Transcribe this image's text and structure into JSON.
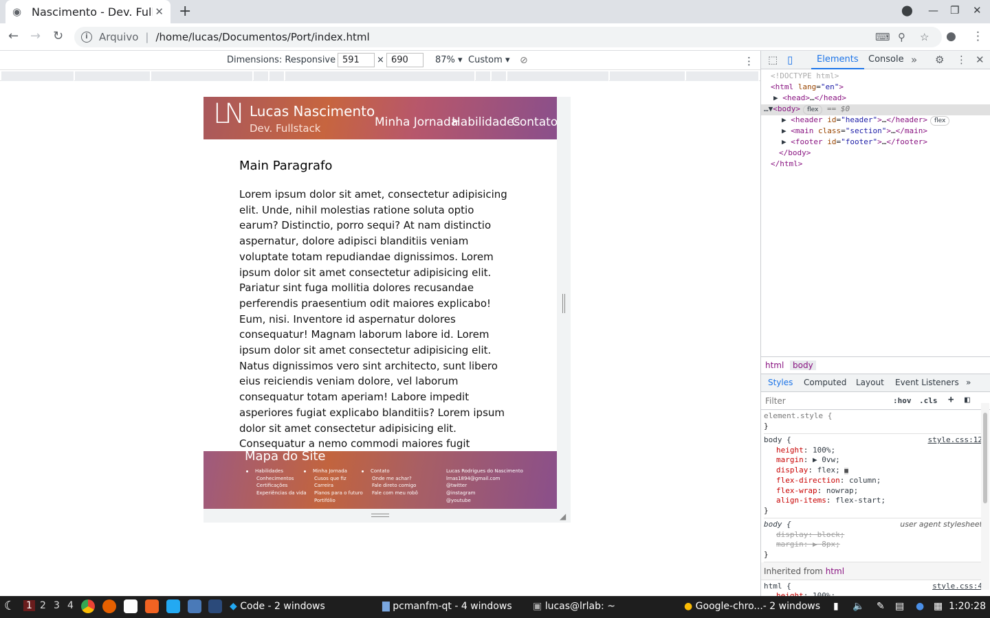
{
  "browser": {
    "tab_title": "Nascimento - Dev. Fullstack",
    "new_tab": "+",
    "address_scheme": "Arquivo",
    "address_path": "/home/lucas/Documentos/Port/index.html"
  },
  "device_toolbar": {
    "dimensions_label": "Dimensions: Responsive",
    "width": "591",
    "height": "690",
    "times": "×",
    "zoom": "87%",
    "throttle": "Custom"
  },
  "site": {
    "logo": "LN",
    "name": "Lucas Nascimento",
    "role": "Dev. Fullstack",
    "menu": [
      "Minha Jornada",
      "Habilidades",
      "Contato"
    ],
    "main_title": "Main Paragrafo",
    "main_text": "Lorem ipsum dolor sit amet, consectetur adipisicing elit. Unde, nihil molestias ratione soluta optio earum? Distinctio, porro sequi? At nam distinctio aspernatur, dolore adipisci blanditiis veniam voluptate totam repudiandae dignissimos. Lorem ipsum dolor sit amet consectetur adipisicing elit. Pariatur sint fuga mollitia dolores recusandae perferendis praesentium odit maiores explicabo! Eum, nisi. Inventore id aspernatur dolores consequatur! Magnam laborum labore id. Lorem ipsum dolor sit amet consectetur adipisicing elit. Natus dignissimos vero sint architecto, sunt libero eius reiciendis veniam dolore, vel laborum consequatur totam aperiam! Labore impedit asperiores fugiat explicabo blanditiis? Lorem ipsum dolor sit amet consectetur adipisicing elit. Consequatur a nemo commodi maiores fugit quisquam labore dolor deleniti, porro dicta tempora? Quod excepturi nemo voluptate! Explicabo",
    "footer": {
      "title": "Mapa do Site",
      "col1": {
        "head": "Habilidades",
        "items": [
          "Conhecimentos",
          "Certificações",
          "Experiências da vida"
        ]
      },
      "col2": {
        "head": "Minha Jornada",
        "items": [
          "Cusos que fiz",
          "Carreira",
          "Planos para o futuro",
          "Portifólio"
        ]
      },
      "col3": {
        "head": "Contato",
        "items": [
          "Onde me achar?",
          "Fale direto comigo",
          "Fale com meu robô"
        ]
      },
      "col4": {
        "items": [
          "Lucas Rodrigues do Nascimento",
          "lrnas1894@gmail.com",
          "@twitter",
          "@instagram",
          "@youtube"
        ]
      }
    }
  },
  "devtools": {
    "tabs": [
      "Elements",
      "Console"
    ],
    "dom": {
      "doctype": "<!DOCTYPE html>",
      "html_open": "html",
      "lang_attr": "lang",
      "lang_val": "en",
      "head": "head",
      "body": "body",
      "body_badge": "flex",
      "eq": "== $0",
      "header_id": "header",
      "header_badge": "flex",
      "main_class": "section",
      "footer_id": "footer",
      "ellipsis": "…"
    },
    "breadcrumbs": [
      "html",
      "body"
    ],
    "style_tabs": [
      "Styles",
      "Computed",
      "Layout",
      "Event Listeners"
    ],
    "filter_placeholder": "Filter",
    "hov": ":hov",
    "cls": ".cls",
    "element_style": "element.style {",
    "rule1": {
      "selector": "body {",
      "source": "style.css:12",
      "props": [
        {
          "n": "height",
          "v": "100%;"
        },
        {
          "n": "margin",
          "v": "▶ 0vw;"
        },
        {
          "n": "display",
          "v": "flex;"
        },
        {
          "n": "flex-direction",
          "v": "column;"
        },
        {
          "n": "flex-wrap",
          "v": "nowrap;"
        },
        {
          "n": "align-items",
          "v": "flex-start;"
        }
      ]
    },
    "rule2": {
      "selector": "body {",
      "source": "user agent stylesheet",
      "props": [
        {
          "n": "display",
          "v": "block;"
        },
        {
          "n": "margin",
          "v": "▶ 8px;"
        }
      ]
    },
    "inherited_label": "Inherited from",
    "inherited_tag": "html",
    "rule3": {
      "selector": "html {",
      "source": "style.css:4",
      "props": [
        {
          "n": "height",
          "v": "100%;"
        }
      ]
    },
    "close_brace": "}"
  },
  "taskbar": {
    "workspaces": [
      "1",
      "2",
      "3",
      "4"
    ],
    "active_workspace": "1",
    "windows": [
      "Code - 2 windows",
      "pcmanfm-qt - 4 windows",
      "lucas@lrlab: ~",
      "Google-chro...- 2 windows"
    ],
    "clock": "1:20:28"
  }
}
